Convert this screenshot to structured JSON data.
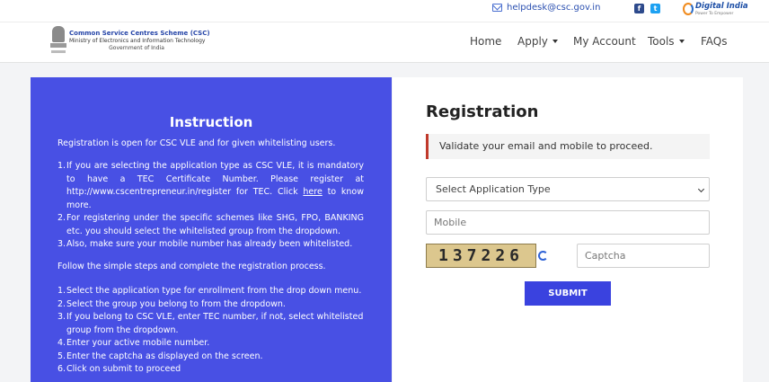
{
  "topbar": {
    "email": "helpdesk@csc.gov.in",
    "social": [
      "f",
      "t"
    ],
    "digital_india": {
      "name": "Digital India",
      "tagline": "Power To Empower"
    }
  },
  "header": {
    "org_name": "Common Service Centres Scheme (CSC)",
    "ministry": "Ministry of Electronics and Information Technology",
    "government": "Government of India",
    "nav": {
      "home": "Home",
      "apply": "Apply",
      "account": "My Account",
      "tools": "Tools",
      "faqs": "FAQs"
    }
  },
  "instruction": {
    "title": "Instruction",
    "intro": "Registration is open for CSC VLE and for given whitelisting users.",
    "rules": {
      "r1": {
        "num": "1.",
        "before": "If you are selecting the application type as CSC VLE, it is mandatory to have a TEC Certificate Number. Please register at http://www.cscentrepreneur.in/register for TEC. Click ",
        "link": "here",
        "after": " to know more."
      },
      "r2": {
        "num": "2.",
        "text": "For registering under the specific schemes like SHG, FPO, BANKING etc. you should select the whitelisted group from the dropdown."
      },
      "r3": {
        "num": "3.",
        "text": "Also, make sure your mobile number has already been whitelisted."
      }
    },
    "follow": "Follow the simple steps and complete the registration process.",
    "steps": {
      "s1": {
        "num": "1.",
        "text": "Select the application type for enrollment from the drop down menu."
      },
      "s2": {
        "num": "2.",
        "text": "Select the group you belong to from the dropdown."
      },
      "s3": {
        "num": "3.",
        "text": "If you belong to CSC VLE, enter TEC number, if not, select whitelisted group from the dropdown."
      },
      "s4": {
        "num": "4.",
        "text": "Enter your active mobile number."
      },
      "s5": {
        "num": "5.",
        "text": "Enter the captcha as displayed on the screen."
      },
      "s6": {
        "num": "6.",
        "text": "Click on submit to proceed"
      }
    }
  },
  "registration": {
    "title": "Registration",
    "alert": "Validate your email and mobile to proceed.",
    "application_type": "Select Application Type",
    "mobile_placeholder": "Mobile",
    "captcha_code": "137226",
    "captcha_placeholder": "Captcha",
    "submit": "SUBMIT"
  },
  "colors": {
    "primary": "#4850e4",
    "button": "#3a42df",
    "alert_border": "#c0392b"
  }
}
